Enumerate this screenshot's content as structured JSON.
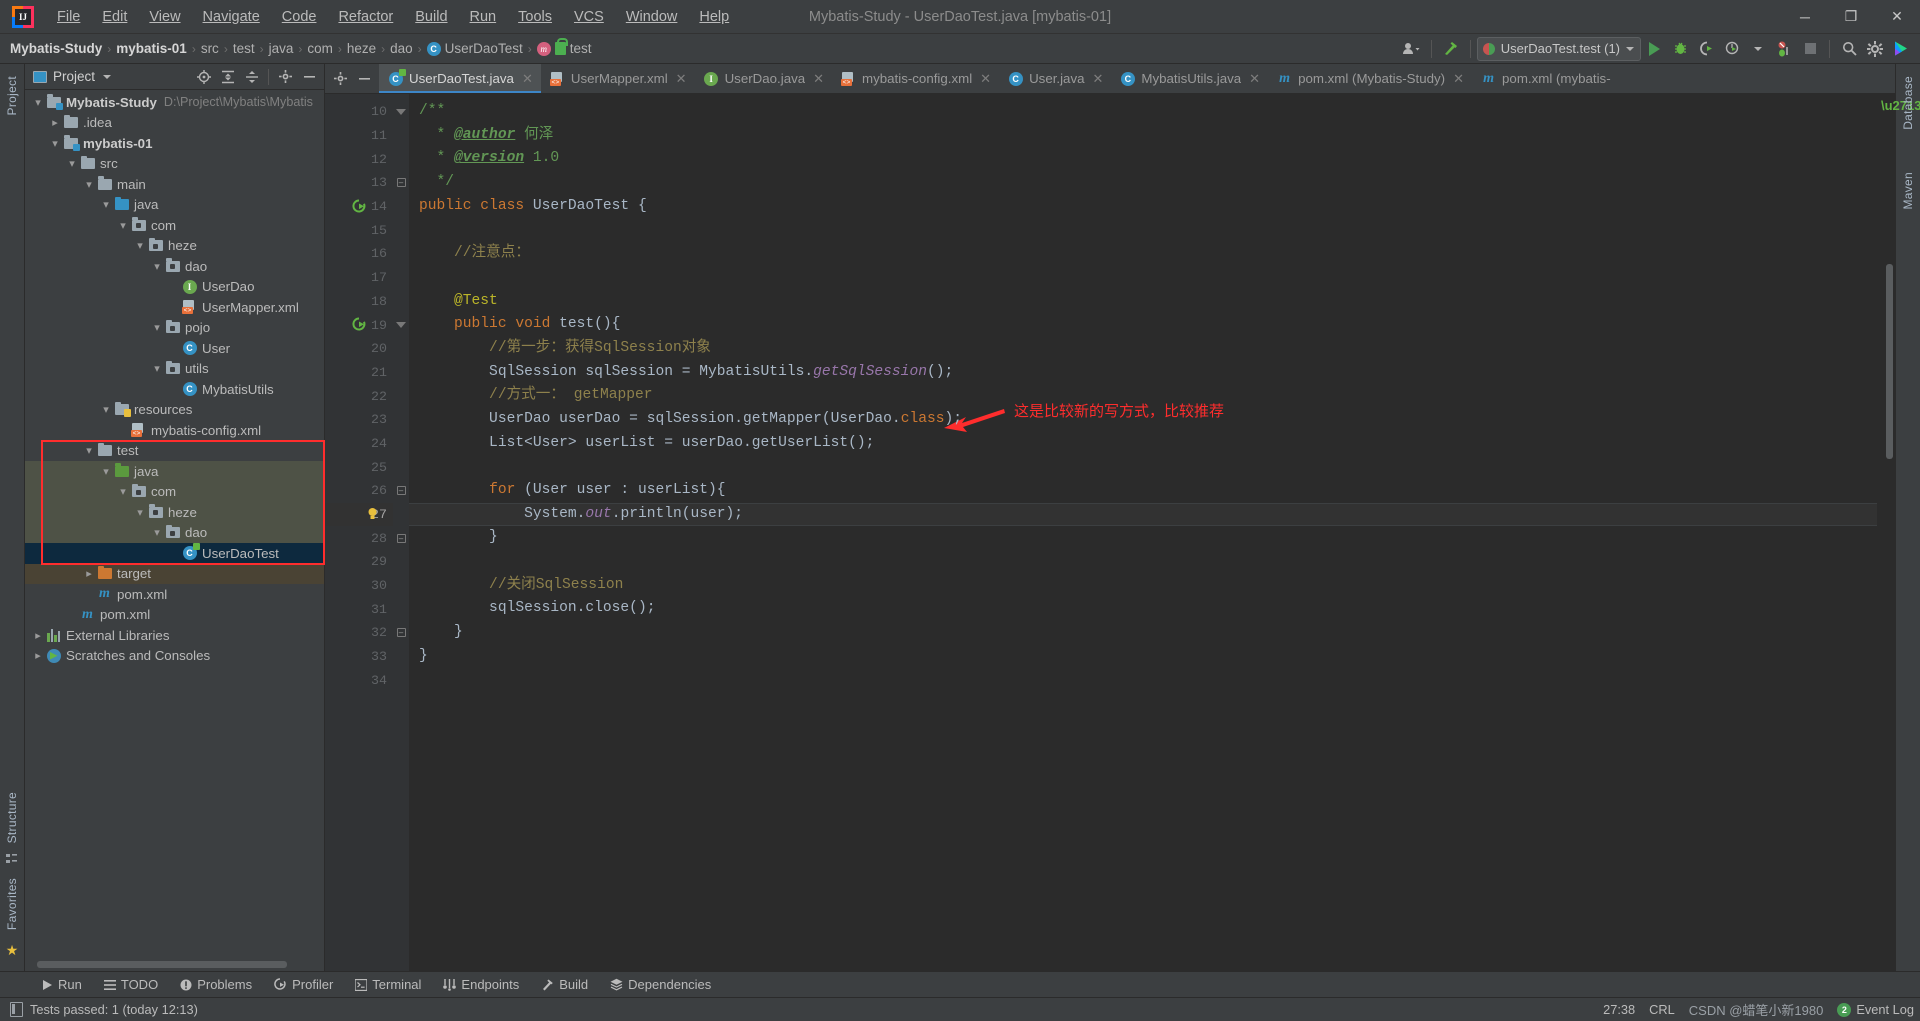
{
  "window": {
    "title": "Mybatis-Study - UserDaoTest.java [mybatis-01]",
    "logo_text": "IJ",
    "controls": {
      "minimize": "─",
      "maximize": "❐",
      "close": "✕"
    }
  },
  "menu": [
    {
      "label": "File"
    },
    {
      "label": "Edit"
    },
    {
      "label": "View"
    },
    {
      "label": "Navigate"
    },
    {
      "label": "Code"
    },
    {
      "label": "Refactor"
    },
    {
      "label": "Build"
    },
    {
      "label": "Run"
    },
    {
      "label": "Tools"
    },
    {
      "label": "VCS"
    },
    {
      "label": "Window"
    },
    {
      "label": "Help"
    }
  ],
  "breadcrumb": {
    "items": [
      {
        "label": "Mybatis-Study",
        "bold": true,
        "icon": "none"
      },
      {
        "label": "mybatis-01",
        "bold": true,
        "icon": "none"
      },
      {
        "label": "src",
        "bold": false,
        "icon": "none"
      },
      {
        "label": "test",
        "bold": false,
        "icon": "none"
      },
      {
        "label": "java",
        "bold": false,
        "icon": "none"
      },
      {
        "label": "com",
        "bold": false,
        "icon": "none"
      },
      {
        "label": "heze",
        "bold": false,
        "icon": "none"
      },
      {
        "label": "dao",
        "bold": false,
        "icon": "none"
      },
      {
        "label": "UserDaoTest",
        "bold": false,
        "icon": "class-icon"
      },
      {
        "label": "test",
        "bold": false,
        "icon": "method-lock-icon"
      }
    ],
    "separator": "›"
  },
  "toolbar": {
    "run_config": "UserDaoTest.test (1)",
    "icons": [
      "user-accounts-icon",
      "build-hammer-icon",
      "run-icon",
      "debug-icon",
      "run-with-coverage-icon",
      "profiler-icon",
      "stop-icon",
      "search-everywhere-icon",
      "settings-gear-icon",
      "updates-icon"
    ]
  },
  "rails": {
    "left_top": "Project",
    "left_bottom_1": "Structure",
    "left_bottom_2": "Favorites",
    "right_top": "Database",
    "right_bottom": "Maven"
  },
  "project_panel": {
    "title": "Project",
    "actions": [
      "locate-icon",
      "expand-all-icon",
      "collapse-all-icon",
      "settings-icon",
      "hide-icon"
    ],
    "tree": [
      {
        "depth": 0,
        "arrow": "down",
        "icon": "module-folder",
        "label": "Mybatis-Study",
        "bold": true,
        "path": "D:\\Project\\Mybatis\\Mybatis",
        "sel": ""
      },
      {
        "depth": 1,
        "arrow": "right",
        "icon": "folder-gray",
        "label": ".idea",
        "bold": false,
        "path": "",
        "sel": ""
      },
      {
        "depth": 1,
        "arrow": "down",
        "icon": "module-folder",
        "label": "mybatis-01",
        "bold": true,
        "path": "",
        "sel": ""
      },
      {
        "depth": 2,
        "arrow": "down",
        "icon": "folder-gray",
        "label": "src",
        "bold": false,
        "path": "",
        "sel": ""
      },
      {
        "depth": 3,
        "arrow": "down",
        "icon": "folder-gray",
        "label": "main",
        "bold": false,
        "path": "",
        "sel": ""
      },
      {
        "depth": 4,
        "arrow": "down",
        "icon": "folder-blue",
        "label": "java",
        "bold": false,
        "path": "",
        "sel": ""
      },
      {
        "depth": 5,
        "arrow": "down",
        "icon": "package",
        "label": "com",
        "bold": false,
        "path": "",
        "sel": ""
      },
      {
        "depth": 6,
        "arrow": "down",
        "icon": "package",
        "label": "heze",
        "bold": false,
        "path": "",
        "sel": ""
      },
      {
        "depth": 7,
        "arrow": "down",
        "icon": "package",
        "label": "dao",
        "bold": false,
        "path": "",
        "sel": ""
      },
      {
        "depth": 8,
        "arrow": "empty",
        "icon": "interface",
        "label": "UserDao",
        "bold": false,
        "path": "",
        "sel": ""
      },
      {
        "depth": 8,
        "arrow": "empty",
        "icon": "xml",
        "label": "UserMapper.xml",
        "bold": false,
        "path": "",
        "sel": ""
      },
      {
        "depth": 7,
        "arrow": "down",
        "icon": "package",
        "label": "pojo",
        "bold": false,
        "path": "",
        "sel": ""
      },
      {
        "depth": 8,
        "arrow": "empty",
        "icon": "class",
        "label": "User",
        "bold": false,
        "path": "",
        "sel": ""
      },
      {
        "depth": 7,
        "arrow": "down",
        "icon": "package",
        "label": "utils",
        "bold": false,
        "path": "",
        "sel": ""
      },
      {
        "depth": 8,
        "arrow": "empty",
        "icon": "class",
        "label": "MybatisUtils",
        "bold": false,
        "path": "",
        "sel": ""
      },
      {
        "depth": 4,
        "arrow": "down",
        "icon": "resources",
        "label": "resources",
        "bold": false,
        "path": "",
        "sel": ""
      },
      {
        "depth": 5,
        "arrow": "empty",
        "icon": "xml",
        "label": "mybatis-config.xml",
        "bold": false,
        "path": "",
        "sel": ""
      },
      {
        "depth": 3,
        "arrow": "down",
        "icon": "folder-gray",
        "label": "test",
        "bold": false,
        "path": "",
        "sel": ""
      },
      {
        "depth": 4,
        "arrow": "down",
        "icon": "folder-green",
        "label": "java",
        "bold": false,
        "path": "",
        "sel": "green"
      },
      {
        "depth": 5,
        "arrow": "down",
        "icon": "package",
        "label": "com",
        "bold": false,
        "path": "",
        "sel": "green"
      },
      {
        "depth": 6,
        "arrow": "down",
        "icon": "package",
        "label": "heze",
        "bold": false,
        "path": "",
        "sel": "green"
      },
      {
        "depth": 7,
        "arrow": "down",
        "icon": "package",
        "label": "dao",
        "bold": false,
        "path": "",
        "sel": "green"
      },
      {
        "depth": 8,
        "arrow": "empty",
        "icon": "test-class",
        "label": "UserDaoTest",
        "bold": false,
        "path": "",
        "sel": "blue"
      },
      {
        "depth": 3,
        "arrow": "right",
        "icon": "folder-orange",
        "label": "target",
        "bold": false,
        "path": "",
        "sel": "brown"
      },
      {
        "depth": 3,
        "arrow": "empty",
        "icon": "maven",
        "label": "pom.xml",
        "bold": false,
        "path": "",
        "sel": ""
      },
      {
        "depth": 2,
        "arrow": "empty",
        "icon": "maven",
        "label": "pom.xml",
        "bold": false,
        "path": "",
        "sel": ""
      },
      {
        "depth": 0,
        "arrow": "right",
        "icon": "libraries",
        "label": "External Libraries",
        "bold": false,
        "path": "",
        "sel": ""
      },
      {
        "depth": 0,
        "arrow": "right",
        "icon": "scratches",
        "label": "Scratches and Consoles",
        "bold": false,
        "path": "",
        "sel": ""
      }
    ]
  },
  "editor_tabs": [
    {
      "label": "UserDaoTest.java",
      "icon": "test-class",
      "active": true,
      "close": "✕"
    },
    {
      "label": "UserMapper.xml",
      "icon": "xml",
      "active": false,
      "close": "✕"
    },
    {
      "label": "UserDao.java",
      "icon": "interface",
      "active": false,
      "close": "✕"
    },
    {
      "label": "mybatis-config.xml",
      "icon": "xml",
      "active": false,
      "close": "✕"
    },
    {
      "label": "User.java",
      "icon": "class",
      "active": false,
      "close": "✕"
    },
    {
      "label": "MybatisUtils.java",
      "icon": "class",
      "active": false,
      "close": "✕"
    },
    {
      "label": "pom.xml (Mybatis-Study)",
      "icon": "maven",
      "active": false,
      "close": "✕"
    },
    {
      "label": "pom.xml (mybatis-",
      "icon": "maven",
      "active": false,
      "close": ""
    }
  ],
  "editor": {
    "first_line": 10,
    "current_line": 27,
    "lines": [
      {
        "n": 10,
        "fold": "tri-down",
        "run": false,
        "bulb": false,
        "tokens": [
          {
            "t": "/**",
            "c": "doc"
          }
        ]
      },
      {
        "n": 11,
        "fold": "",
        "run": false,
        "bulb": false,
        "tokens": [
          {
            "t": "  * ",
            "c": "doc"
          },
          {
            "t": "@author",
            "c": "doc-tag"
          },
          {
            "t": " 何泽",
            "c": "doc"
          }
        ]
      },
      {
        "n": 12,
        "fold": "",
        "run": false,
        "bulb": false,
        "tokens": [
          {
            "t": "  * ",
            "c": "doc"
          },
          {
            "t": "@version",
            "c": "doc-tag"
          },
          {
            "t": " 1.0",
            "c": "doc"
          }
        ]
      },
      {
        "n": 13,
        "fold": "box-minus",
        "run": false,
        "bulb": false,
        "tokens": [
          {
            "t": "  */",
            "c": "doc"
          }
        ]
      },
      {
        "n": 14,
        "fold": "",
        "run": true,
        "bulb": false,
        "tokens": [
          {
            "t": "public class ",
            "c": "kw"
          },
          {
            "t": "UserDaoTest ",
            "c": "id"
          },
          {
            "t": "{",
            "c": "id"
          }
        ]
      },
      {
        "n": 15,
        "fold": "",
        "run": false,
        "bulb": false,
        "tokens": []
      },
      {
        "n": 16,
        "fold": "",
        "run": false,
        "bulb": false,
        "tokens": [
          {
            "t": "    //注意点：",
            "c": "cmz"
          }
        ]
      },
      {
        "n": 17,
        "fold": "",
        "run": false,
        "bulb": false,
        "tokens": []
      },
      {
        "n": 18,
        "fold": "",
        "run": false,
        "bulb": false,
        "tokens": [
          {
            "t": "    @Test",
            "c": "ann"
          }
        ]
      },
      {
        "n": 19,
        "fold": "tri-down",
        "run": true,
        "bulb": false,
        "tokens": [
          {
            "t": "    ",
            "c": "id"
          },
          {
            "t": "public void ",
            "c": "kw"
          },
          {
            "t": "test",
            "c": "id"
          },
          {
            "t": "(){",
            "c": "id"
          }
        ]
      },
      {
        "n": 20,
        "fold": "",
        "run": false,
        "bulb": false,
        "tokens": [
          {
            "t": "        //第一步：获得SqlSession对象",
            "c": "cmz"
          }
        ]
      },
      {
        "n": 21,
        "fold": "",
        "run": false,
        "bulb": false,
        "tokens": [
          {
            "t": "        SqlSession sqlSession = MybatisUtils.",
            "c": "id"
          },
          {
            "t": "getSqlSession",
            "c": "stat"
          },
          {
            "t": "();",
            "c": "id"
          }
        ]
      },
      {
        "n": 22,
        "fold": "",
        "run": false,
        "bulb": false,
        "tokens": [
          {
            "t": "        //方式一： getMapper",
            "c": "cmz"
          }
        ]
      },
      {
        "n": 23,
        "fold": "",
        "run": false,
        "bulb": false,
        "tokens": [
          {
            "t": "        UserDao userDao = sqlSession.getMapper(UserDao.",
            "c": "id"
          },
          {
            "t": "class",
            "c": "kw"
          },
          {
            "t": ");",
            "c": "id"
          }
        ]
      },
      {
        "n": 24,
        "fold": "",
        "run": false,
        "bulb": false,
        "tokens": [
          {
            "t": "        List<User> userList = userDao.getUserList();",
            "c": "id"
          }
        ]
      },
      {
        "n": 25,
        "fold": "",
        "run": false,
        "bulb": false,
        "tokens": []
      },
      {
        "n": 26,
        "fold": "box-minus",
        "run": false,
        "bulb": false,
        "tokens": [
          {
            "t": "        ",
            "c": "id"
          },
          {
            "t": "for ",
            "c": "kw"
          },
          {
            "t": "(User user : userList){",
            "c": "id"
          }
        ]
      },
      {
        "n": 27,
        "fold": "",
        "run": false,
        "bulb": true,
        "tokens": [
          {
            "t": "            System.",
            "c": "id"
          },
          {
            "t": "out",
            "c": "stat"
          },
          {
            "t": ".println(user);",
            "c": "id"
          }
        ]
      },
      {
        "n": 28,
        "fold": "box-minus",
        "run": false,
        "bulb": false,
        "tokens": [
          {
            "t": "        }",
            "c": "id"
          }
        ]
      },
      {
        "n": 29,
        "fold": "",
        "run": false,
        "bulb": false,
        "tokens": []
      },
      {
        "n": 30,
        "fold": "",
        "run": false,
        "bulb": false,
        "tokens": [
          {
            "t": "        //关闭SqlSession",
            "c": "cmz"
          }
        ]
      },
      {
        "n": 31,
        "fold": "",
        "run": false,
        "bulb": false,
        "tokens": [
          {
            "t": "        sqlSession.close();",
            "c": "id"
          }
        ]
      },
      {
        "n": 32,
        "fold": "box-minus",
        "run": false,
        "bulb": false,
        "tokens": [
          {
            "t": "    }",
            "c": "id"
          }
        ]
      },
      {
        "n": 33,
        "fold": "",
        "run": false,
        "bulb": false,
        "tokens": [
          {
            "t": "}",
            "c": "id"
          }
        ]
      },
      {
        "n": 34,
        "fold": "",
        "run": false,
        "bulb": false,
        "tokens": []
      }
    ],
    "annotation": {
      "text": "这是比较新的写方式，比较推荐",
      "color": "#ff2d2d"
    }
  },
  "tool_windows": [
    {
      "label": "Run",
      "icon": "run-icon"
    },
    {
      "label": "TODO",
      "icon": "todo-icon"
    },
    {
      "label": "Problems",
      "icon": "problems-icon"
    },
    {
      "label": "Profiler",
      "icon": "profiler-icon"
    },
    {
      "label": "Terminal",
      "icon": "terminal-icon"
    },
    {
      "label": "Endpoints",
      "icon": "endpoints-icon"
    },
    {
      "label": "Build",
      "icon": "build-icon"
    },
    {
      "label": "Dependencies",
      "icon": "dependencies-icon"
    }
  ],
  "status_bar": {
    "message": "Tests passed: 1 (today 12:13)",
    "caret": "27:38",
    "line_separator": "CRL",
    "watermark": "CSDN @蜡笔小新1980",
    "event_log": "Event Log",
    "event_count": "2"
  }
}
